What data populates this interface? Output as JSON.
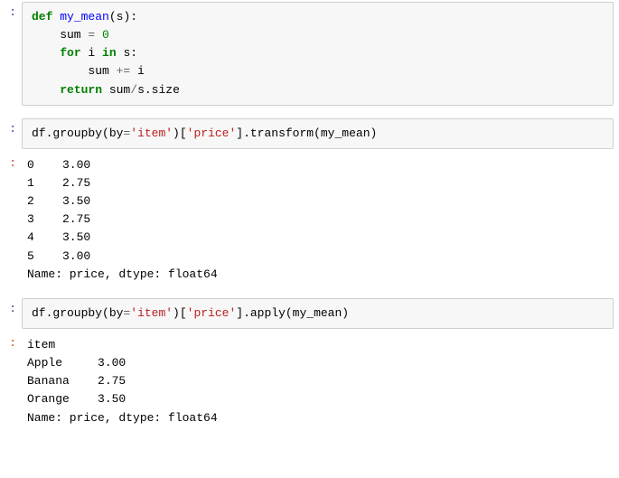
{
  "cells": [
    {
      "prompt": ":",
      "type": "code",
      "code": {
        "kw_def": "def",
        "fn_name": "my_mean",
        "paren_open": "(",
        "param": "s",
        "paren_close_colon": "):",
        "line2_a": "    sum ",
        "line2_eq": "=",
        "line2_sp": " ",
        "line2_zero": "0",
        "line3_indent": "    ",
        "kw_for": "for",
        "line3_sp1": " i ",
        "kw_in": "in",
        "line3_rest": " s:",
        "line4_a": "        sum ",
        "line4_peq": "+=",
        "line4_b": " i",
        "line5_indent": "    ",
        "kw_return": "return",
        "line5_a": " sum",
        "line5_div": "/",
        "line5_b": "s.size"
      }
    },
    {
      "prompt": ":",
      "type": "code",
      "code": {
        "a": "df.groupby(by",
        "eq": "=",
        "str1": "'item'",
        "b": ")[",
        "str2": "'price'",
        "c": "].transform(my_mean)"
      }
    },
    {
      "prompt": ":",
      "type": "output",
      "output": "0    3.00\n1    2.75\n2    3.50\n3    2.75\n4    3.50\n5    3.00\nName: price, dtype: float64"
    },
    {
      "prompt": ":",
      "type": "code",
      "code": {
        "a": "df.groupby(by",
        "eq": "=",
        "str1": "'item'",
        "b": ")[",
        "str2": "'price'",
        "c": "].apply(my_mean)"
      }
    },
    {
      "prompt": ":",
      "type": "output",
      "output": "item\nApple     3.00\nBanana    2.75\nOrange    3.50\nName: price, dtype: float64"
    }
  ],
  "chart_data": {
    "type": "table",
    "transform_result": {
      "index": [
        0,
        1,
        2,
        3,
        4,
        5
      ],
      "values": [
        3.0,
        2.75,
        3.5,
        2.75,
        3.5,
        3.0
      ],
      "name": "price",
      "dtype": "float64"
    },
    "apply_result": {
      "index_name": "item",
      "index": [
        "Apple",
        "Banana",
        "Orange"
      ],
      "values": [
        3.0,
        2.75,
        3.5
      ],
      "name": "price",
      "dtype": "float64"
    }
  }
}
